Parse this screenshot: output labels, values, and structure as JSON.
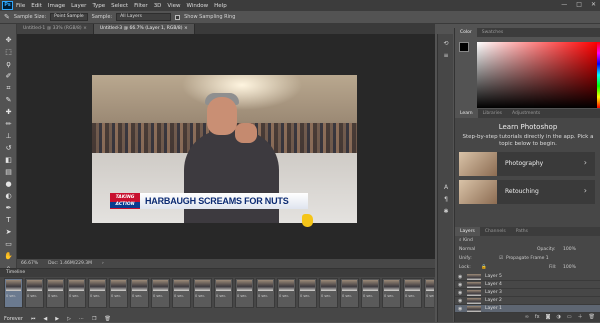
{
  "menubar": {
    "logo": "Ps",
    "items": [
      "File",
      "Edit",
      "Image",
      "Layer",
      "Type",
      "Select",
      "Filter",
      "3D",
      "View",
      "Window",
      "Help"
    ],
    "window_controls": [
      "—",
      "□",
      "✕"
    ]
  },
  "options": {
    "sample_size_label": "Sample Size:",
    "sample_size_value": "Point Sample",
    "sample_label": "Sample:",
    "sample_value": "All Layers",
    "show_ring_label": "Show Sampling Ring"
  },
  "tabs": [
    {
      "label": "Untitled-1 @ 33% (RGB/8) ×",
      "active": false
    },
    {
      "label": "Untitled-3 @ 66.7% (Layer 1, RGB/8) ×",
      "active": true
    }
  ],
  "image": {
    "lower_third_tag_line1": "TAKING",
    "lower_third_tag_line2": "ACTION",
    "headline": "HARBAUGH SCREAMS FOR NUTS"
  },
  "status": {
    "zoom": "66.67%",
    "doc_size": "Doc: 1.46M/229.3M"
  },
  "timeline": {
    "title": "Timeline",
    "frame_duration": "0 sec.",
    "frame_count": 22,
    "selected_frame": 1,
    "loop_label": "Forever"
  },
  "panels": {
    "color_tabs": [
      "Color",
      "Swatches"
    ],
    "color_accent": "#ff0000",
    "learn_tabs": [
      "Learn",
      "Libraries",
      "Adjustments"
    ],
    "learn_title": "Learn Photoshop",
    "learn_desc": "Step-by-step tutorials directly in the app. Pick a topic below to begin.",
    "learn_cards": [
      {
        "label": "Photography"
      },
      {
        "label": "Retouching"
      }
    ],
    "layers_tabs": [
      "Layers",
      "Channels",
      "Paths"
    ],
    "kind_label": "Kind",
    "blend_mode": "Normal",
    "opacity_label": "Opacity:",
    "opacity_value": "100%",
    "lock_label": "Lock:",
    "propagate_label": "Propagate Frame 1",
    "fill_label": "Fill:",
    "fill_value": "100%",
    "layers": [
      "Layer 5",
      "Layer 4",
      "Layer 3",
      "Layer 2",
      "Layer 1"
    ],
    "selected_layer": "Layer 1"
  }
}
